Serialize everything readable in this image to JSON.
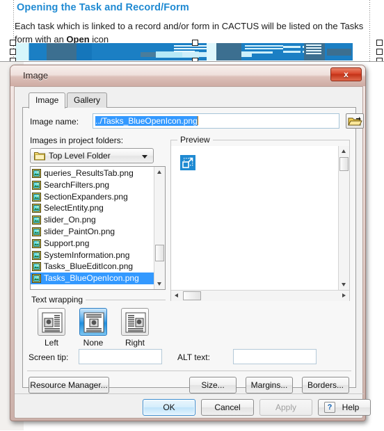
{
  "document": {
    "heading": "Opening the Task and Record/Form",
    "paragraph_part1": "Each task which is linked to a record and/or form in CACTUS will be listed on the Tasks form with an ",
    "paragraph_bold": "Open",
    "paragraph_part2": " icon",
    "banner_alt": "blue-banner-image",
    "heading_color": "#1f8ad2"
  },
  "dialog": {
    "title": "Image",
    "close_label": "x",
    "tabs": [
      {
        "label": "Image",
        "active": true
      },
      {
        "label": "Gallery",
        "active": false
      }
    ],
    "image_name": {
      "label": "Image name:",
      "value": "../Tasks_BlueOpenIcon.png",
      "placeholder": "",
      "browse_icon": "open-folder-icon"
    },
    "project_folders": {
      "label": "Images in project folders:",
      "selected": "Top Level Folder",
      "folder_icon": "folder-icon",
      "files": [
        "queries_ResultsTab.png",
        "SearchFilters.png",
        "SectionExpanders.png",
        "SelectEntity.png",
        "slider_On.png",
        "slider_PaintOn.png",
        "Support.png",
        "SystemInformation.png",
        "Tasks_BlueEditIcon.png",
        "Tasks_BlueOpenIcon.png"
      ],
      "selected_file": "Tasks_BlueOpenIcon.png"
    },
    "preview": {
      "label": "Preview",
      "image_alt": "blue-open-icon-preview"
    },
    "text_wrapping": {
      "label": "Text wrapping",
      "options": [
        {
          "label": "Left",
          "selected": false,
          "icon": "wrap-left-icon"
        },
        {
          "label": "None",
          "selected": true,
          "icon": "wrap-none-icon"
        },
        {
          "label": "Right",
          "selected": false,
          "icon": "wrap-right-icon"
        }
      ]
    },
    "screen_tip": {
      "label": "Screen tip:",
      "value": "",
      "placeholder": ""
    },
    "alt_text": {
      "label": "ALT text:",
      "value": "",
      "placeholder": ""
    },
    "action_buttons": {
      "resource_manager": "Resource Manager...",
      "size": "Size...",
      "margins": "Margins...",
      "borders": "Borders..."
    },
    "footer_buttons": {
      "ok": "OK",
      "cancel": "Cancel",
      "apply": "Apply",
      "apply_disabled": true,
      "help": "Help",
      "help_icon": "question-mark-icon"
    },
    "colors": {
      "titlebar": "#dcc0b9",
      "close_button": "#d9452a",
      "selection": "#3399ff",
      "default_button_border": "#3c8ed0"
    }
  }
}
